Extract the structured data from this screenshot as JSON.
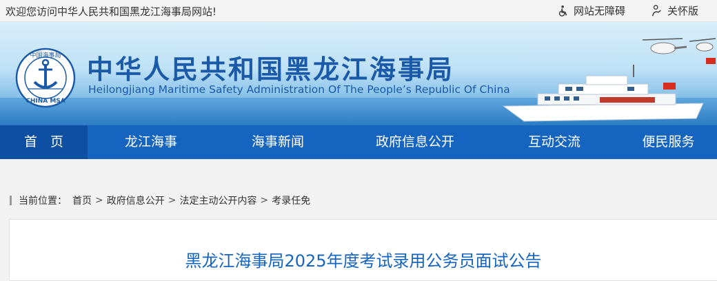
{
  "topbar": {
    "welcome": "欢迎您访问中华人民共和国黑龙江海事局网站!",
    "accessibility_label": "网站无障碍",
    "care_label": "关怀版"
  },
  "banner": {
    "title_cn": "中华人民共和国黑龙江海事局",
    "title_en": "Heilongjiang Maritime Safety Administration Of The People’s Republic Of China",
    "logo": {
      "top_text": "中国海事局",
      "bottom_text": "CHINA MSA"
    }
  },
  "nav": {
    "items": [
      {
        "label": "首　页"
      },
      {
        "label": "龙江海事"
      },
      {
        "label": "海事新闻"
      },
      {
        "label": "政府信息公开"
      },
      {
        "label": "互动交流"
      },
      {
        "label": "便民服务"
      }
    ]
  },
  "breadcrumb": {
    "prefix": "当前位置：",
    "items": [
      "首页",
      "政府信息公开",
      "法定主动公开内容",
      "考录任免"
    ],
    "separator": ">"
  },
  "article": {
    "title": "黑龙江海事局2025年度考试录用公务员面试公告"
  },
  "colors": {
    "brand_blue": "#1565c0",
    "nav_active": "#0c4fa3"
  }
}
